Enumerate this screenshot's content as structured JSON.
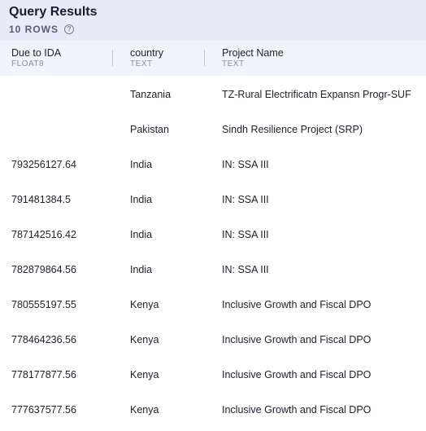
{
  "header": {
    "title": "Query Results",
    "row_count": "10 ROWS",
    "help_icon": "question-circle-icon"
  },
  "columns": [
    {
      "name": "Due to IDA",
      "type": "FLOAT8"
    },
    {
      "name": "country",
      "type": "TEXT"
    },
    {
      "name": "Project Name",
      "type": "TEXT"
    }
  ],
  "rows": [
    {
      "due": "",
      "country": "Tanzania",
      "project": "TZ-Rural Electrificatn Expansn Progr-SUF"
    },
    {
      "due": "",
      "country": "Pakistan",
      "project": "Sindh Resilience Project (SRP)"
    },
    {
      "due": "793256127.64",
      "country": "India",
      "project": "IN: SSA III"
    },
    {
      "due": "791481384.5",
      "country": "India",
      "project": "IN: SSA III"
    },
    {
      "due": "787142516.42",
      "country": "India",
      "project": "IN: SSA III"
    },
    {
      "due": "782879864.56",
      "country": "India",
      "project": "IN: SSA III"
    },
    {
      "due": "780555197.55",
      "country": "Kenya",
      "project": "Inclusive Growth and Fiscal DPO"
    },
    {
      "due": "778464236.56",
      "country": "Kenya",
      "project": "Inclusive Growth and Fiscal DPO"
    },
    {
      "due": "778177877.56",
      "country": "Kenya",
      "project": "Inclusive Growth and Fiscal DPO"
    },
    {
      "due": "777637577.56",
      "country": "Kenya",
      "project": "Inclusive Growth and Fiscal DPO"
    }
  ]
}
